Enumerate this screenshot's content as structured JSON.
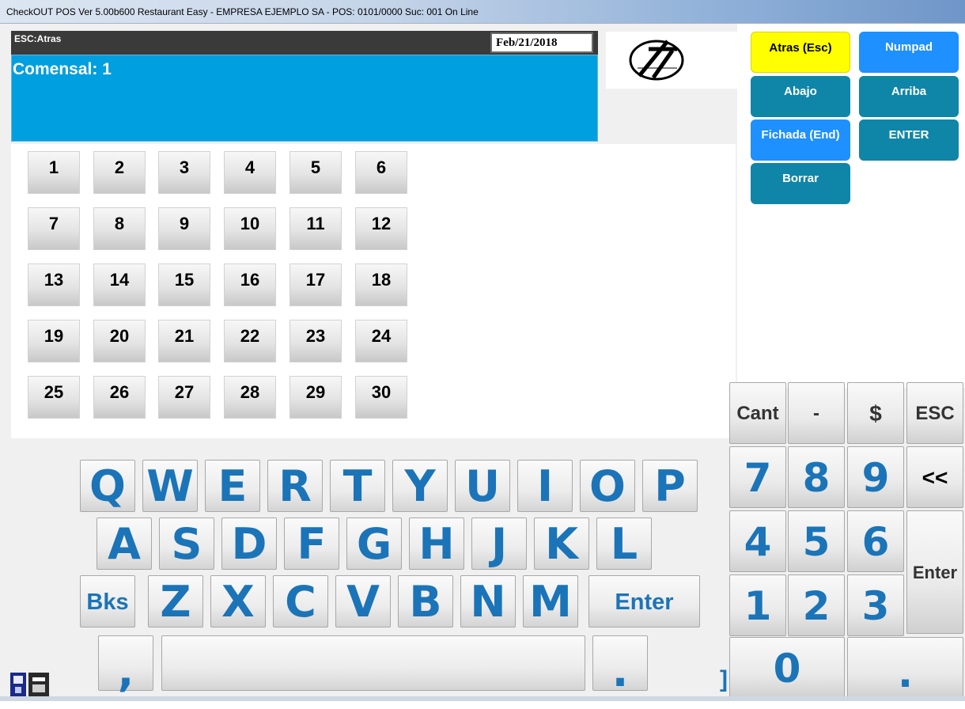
{
  "window": {
    "title": "CheckOUT POS Ver 5.00b600 Restaurant Easy - EMPRESA EJEMPLO SA - POS: 0101/0000 Suc: 001  On Line"
  },
  "header": {
    "esc_label": "ESC:Atras",
    "date": "Feb/21/2018",
    "comensal": "Comensal: 1"
  },
  "numbers": [
    "1",
    "2",
    "3",
    "4",
    "5",
    "6",
    "7",
    "8",
    "9",
    "10",
    "11",
    "12",
    "13",
    "14",
    "15",
    "16",
    "17",
    "18",
    "19",
    "20",
    "21",
    "22",
    "23",
    "24",
    "25",
    "26",
    "27",
    "28",
    "29",
    "30"
  ],
  "actions": {
    "atras": "Atras (Esc)",
    "numpad": "Numpad",
    "abajo": "Abajo",
    "arriba": "Arriba",
    "fichada": "Fichada (End)",
    "enter": "ENTER",
    "borrar": "Borrar"
  },
  "keyboard": {
    "row1": [
      "Q",
      "W",
      "E",
      "R",
      "T",
      "Y",
      "U",
      "I",
      "O",
      "P"
    ],
    "row2": [
      "A",
      "S",
      "D",
      "F",
      "G",
      "H",
      "J",
      "K",
      "L"
    ],
    "row3": [
      "Z",
      "X",
      "C",
      "V",
      "B",
      "N",
      "M"
    ],
    "bks": "Bks",
    "enter": "Enter",
    "comma": ",",
    "dot": "."
  },
  "numpad": {
    "cant": "Cant",
    "minus": "-",
    "dollar": "$",
    "esc": "ESC",
    "back": "<<",
    "enter": "Enter",
    "digits": [
      "7",
      "8",
      "9",
      "4",
      "5",
      "6",
      "1",
      "2",
      "3"
    ],
    "zero": "0",
    "dot": "."
  },
  "colors": {
    "header_blue": "#009fdf",
    "yellow": "#ffff00",
    "blue": "#1e90ff",
    "teal": "#0f86a8",
    "key_text": "#1b74b8"
  },
  "icons": {
    "logo": "logo-7-icon",
    "taskbar": "app-taskbar-icon"
  }
}
